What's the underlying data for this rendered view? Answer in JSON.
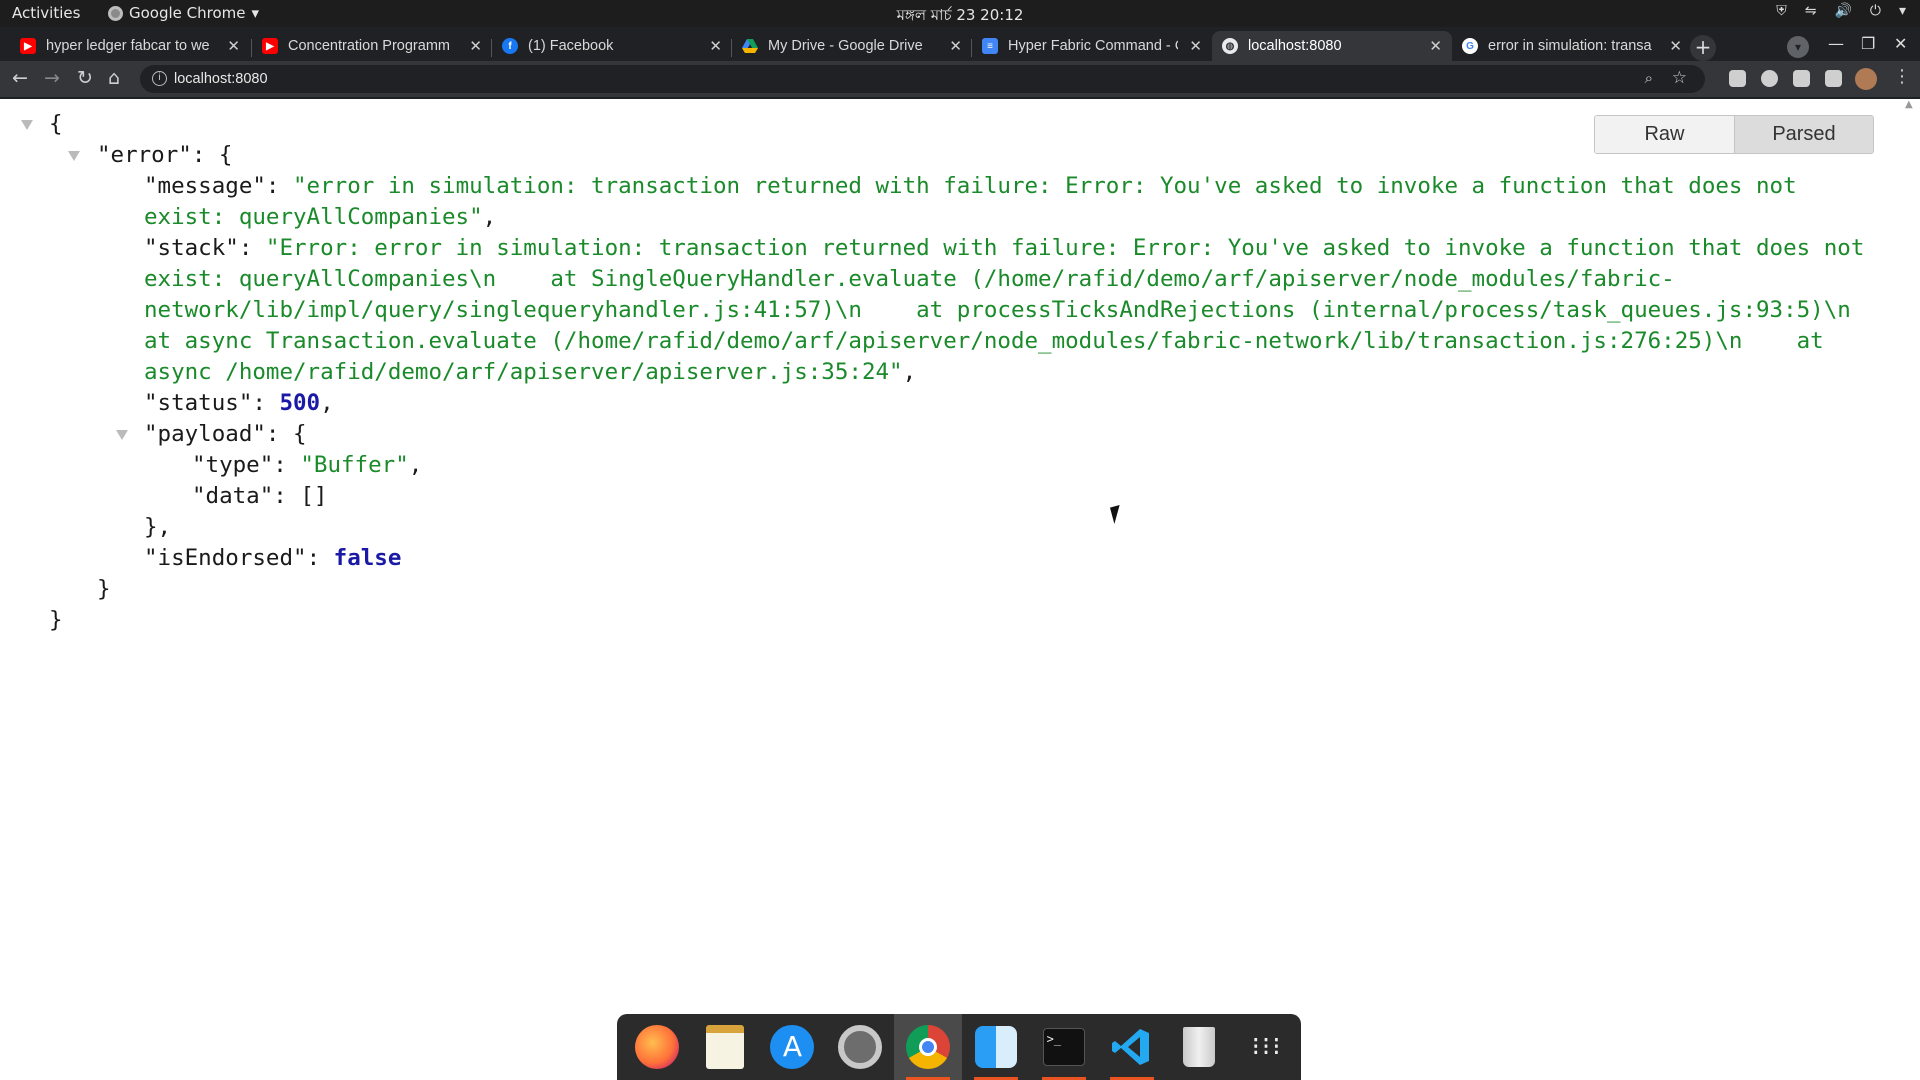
{
  "system_bar": {
    "activities": "Activities",
    "app_name": "Google Chrome",
    "clock": "মঙ্গল মার্চ 23  20:12"
  },
  "tabs": [
    {
      "title": "hyper ledger fabcar to we",
      "favicon": "youtube-icon",
      "color": "#ff0000"
    },
    {
      "title": "Concentration Programm",
      "favicon": "youtube-icon",
      "color": "#ff0000"
    },
    {
      "title": "(1) Facebook",
      "favicon": "facebook-icon",
      "color": "#1877f2"
    },
    {
      "title": "My Drive - Google Drive",
      "favicon": "google-drive-icon",
      "color": "#f4b400"
    },
    {
      "title": "Hyper Fabric Command - C",
      "favicon": "google-docs-icon",
      "color": "#4285f4"
    },
    {
      "title": "localhost:8080",
      "favicon": "globe-icon",
      "color": "#e8eaed"
    },
    {
      "title": "error in simulation: transa",
      "favicon": "google-icon",
      "color": "#4285f4"
    }
  ],
  "address_bar": {
    "url": "localhost:8080"
  },
  "viewer": {
    "raw_label": "Raw",
    "parsed_label": "Parsed",
    "key_error": "\"error\"",
    "key_message": "\"message\"",
    "message_line1": "\"error in simulation: transaction returned with failure: Error: You've asked to invoke a function that does not",
    "message_line2": "exist: queryAllCompanies\"",
    "key_stack": "\"stack\"",
    "stack_line1": "\"Error: error in simulation: transaction returned with failure: Error: You've asked to invoke a function that does not",
    "stack_line2": "exist: queryAllCompanies\\n    at SingleQueryHandler.evaluate (/home/rafid/demo/arf/apiserver/node_modules/fabric-",
    "stack_line3": "network/lib/impl/query/singlequeryhandler.js:41:57)\\n    at processTicksAndRejections (internal/process/task_queues.js:93:5)\\n",
    "stack_line4": "at async Transaction.evaluate (/home/rafid/demo/arf/apiserver/node_modules/fabric-network/lib/transaction.js:276:25)\\n    at",
    "stack_line5": "async /home/rafid/demo/arf/apiserver/apiserver.js:35:24\"",
    "key_status": "\"status\"",
    "status_value": "500",
    "key_payload": "\"payload\"",
    "key_type": "\"type\"",
    "type_value": "\"Buffer\"",
    "key_data": "\"data\"",
    "data_value": "[]",
    "key_isEndorsed": "\"isEndorsed\"",
    "isEndorsed_value": "false"
  },
  "dock": [
    "firefox-icon",
    "text-editor-icon",
    "app-store-icon",
    "settings-icon",
    "chrome-icon",
    "finder-icon",
    "terminal-icon",
    "vscode-icon",
    "trash-icon",
    "app-grid-icon"
  ]
}
